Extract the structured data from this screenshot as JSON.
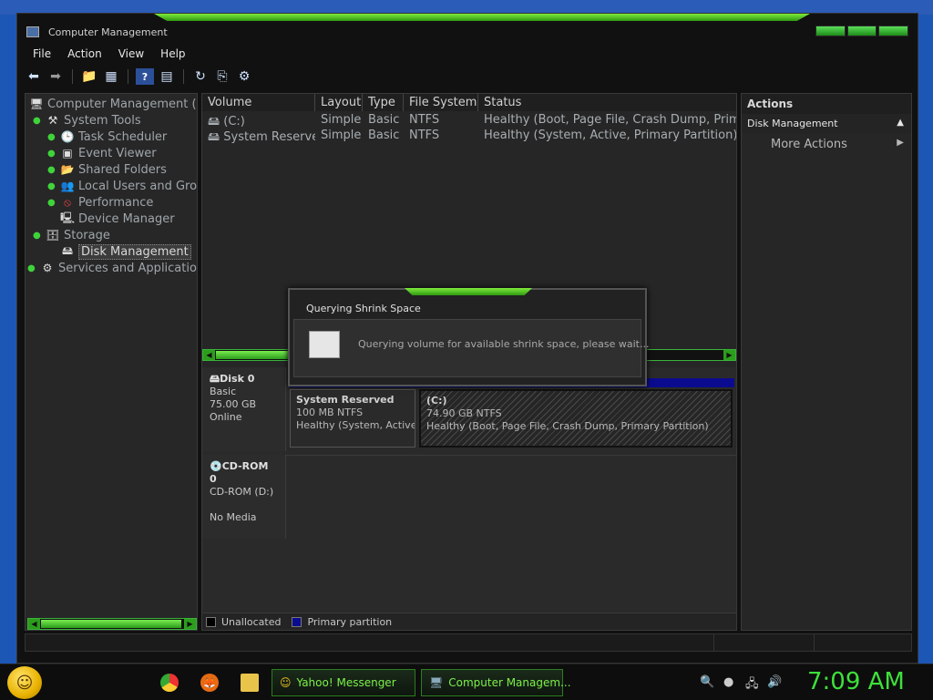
{
  "window": {
    "title": "Computer Management"
  },
  "menu": [
    "File",
    "Action",
    "View",
    "Help"
  ],
  "toolbar_icons": [
    "back-arrow-icon",
    "forward-arrow-icon",
    "up-folder-icon",
    "show-hide-tree-icon",
    "help-icon",
    "properties-icon",
    "refresh-icon",
    "export-icon",
    "settings-icon"
  ],
  "tree": [
    {
      "label": "Computer Management (Loc",
      "level": 0,
      "icon": "computer-icon"
    },
    {
      "label": "System Tools",
      "level": 1,
      "icon": "tools-icon"
    },
    {
      "label": "Task Scheduler",
      "level": 2,
      "icon": "clock-icon"
    },
    {
      "label": "Event Viewer",
      "level": 2,
      "icon": "event-viewer-icon"
    },
    {
      "label": "Shared Folders",
      "level": 2,
      "icon": "shared-folder-icon"
    },
    {
      "label": "Local Users and Grou",
      "level": 2,
      "icon": "users-icon"
    },
    {
      "label": "Performance",
      "level": 2,
      "icon": "performance-icon"
    },
    {
      "label": "Device Manager",
      "level": 2,
      "icon": "device-manager-icon"
    },
    {
      "label": "Storage",
      "level": 1,
      "icon": "storage-icon"
    },
    {
      "label": "Disk Management",
      "level": 2,
      "icon": "disk-management-icon",
      "selected": true
    },
    {
      "label": "Services and Applications",
      "level": 1,
      "icon": "services-icon"
    }
  ],
  "volume_table": {
    "columns": [
      "Volume",
      "Layout",
      "Type",
      "File System",
      "Status"
    ],
    "rows": [
      {
        "volume": "(C:)",
        "layout": "Simple",
        "type": "Basic",
        "fs": "NTFS",
        "status": "Healthy (Boot, Page File, Crash Dump, Primary"
      },
      {
        "volume": "System Reserved",
        "layout": "Simple",
        "type": "Basic",
        "fs": "NTFS",
        "status": "Healthy (System, Active, Primary Partition)"
      }
    ]
  },
  "disks": [
    {
      "name": "Disk 0",
      "type": "Basic",
      "size": "75.00 GB",
      "state": "Online",
      "partitions": [
        {
          "name": "System Reserved",
          "size": "100 MB NTFS",
          "status": "Healthy (System, Active, P"
        },
        {
          "name": "(C:)",
          "size": "74.90 GB NTFS",
          "status": "Healthy (Boot, Page File, Crash Dump, Primary Partition)"
        }
      ]
    },
    {
      "name": "CD-ROM 0",
      "type": "CD-ROM (D:)",
      "state": "No Media"
    }
  ],
  "legend": [
    {
      "label": "Unallocated",
      "color": "#000000"
    },
    {
      "label": "Primary partition",
      "color": "#0b0b90"
    }
  ],
  "actions": {
    "header": "Actions",
    "section": "Disk Management",
    "item": "More Actions"
  },
  "dialog": {
    "title": "Querying Shrink Space",
    "message": "Querying volume for available shrink space, please wait..."
  },
  "taskbar": {
    "tasks": [
      "Yahoo! Messenger",
      "Computer Managem..."
    ],
    "clock": "7:09 AM"
  },
  "colors": {
    "accent_green": "#3ee03a",
    "window_bg": "#111111",
    "primary_partition": "#0b0b90"
  }
}
